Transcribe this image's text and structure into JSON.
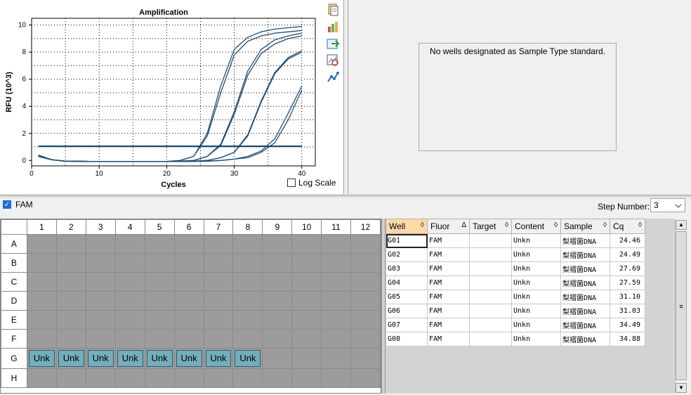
{
  "chart_data": {
    "type": "line",
    "title": "Amplification",
    "xlabel": "Cycles",
    "ylabel": "RFU (10^3)",
    "xlim": [
      0,
      42
    ],
    "ylim": [
      -0.4,
      10.5
    ],
    "xticks": [
      0,
      10,
      20,
      30,
      40
    ],
    "yticks": [
      0,
      2,
      4,
      6,
      8,
      10
    ],
    "grid": true,
    "threshold": 1.05,
    "series_color": "#1f4e79",
    "threshold_color": "#0b3d6e",
    "x": [
      1,
      3,
      5,
      10,
      15,
      20,
      22,
      24,
      26,
      28,
      30,
      32,
      34,
      36,
      38,
      40
    ],
    "series": [
      {
        "values": [
          0.35,
          0.05,
          -0.05,
          -0.08,
          -0.08,
          -0.07,
          0.0,
          0.3,
          2.0,
          5.5,
          8.2,
          9.1,
          9.5,
          9.7,
          9.8,
          9.9
        ]
      },
      {
        "values": [
          0.4,
          0.05,
          -0.05,
          -0.08,
          -0.08,
          -0.07,
          0.0,
          0.3,
          1.8,
          5.0,
          7.8,
          8.8,
          9.2,
          9.4,
          9.5,
          9.6
        ]
      },
      {
        "values": [
          0.3,
          0.05,
          -0.05,
          -0.08,
          -0.08,
          -0.08,
          -0.05,
          0.0,
          0.3,
          1.2,
          3.6,
          6.6,
          8.2,
          8.9,
          9.2,
          9.4
        ]
      },
      {
        "values": [
          0.3,
          0.05,
          -0.05,
          -0.08,
          -0.08,
          -0.08,
          -0.05,
          0.0,
          0.3,
          1.1,
          3.4,
          6.3,
          7.9,
          8.6,
          9.0,
          9.2
        ]
      },
      {
        "values": [
          0.35,
          0.05,
          -0.05,
          -0.08,
          -0.08,
          -0.08,
          -0.07,
          -0.05,
          0.0,
          0.2,
          0.6,
          1.8,
          4.3,
          6.4,
          7.5,
          8.0
        ]
      },
      {
        "values": [
          0.3,
          0.05,
          -0.05,
          -0.08,
          -0.08,
          -0.08,
          -0.07,
          -0.05,
          0.0,
          0.2,
          0.6,
          1.9,
          4.4,
          6.5,
          7.6,
          8.1
        ]
      },
      {
        "values": [
          0.3,
          0.05,
          -0.05,
          -0.08,
          -0.08,
          -0.08,
          -0.08,
          -0.07,
          -0.05,
          0.0,
          0.1,
          0.3,
          0.7,
          1.6,
          3.5,
          5.5
        ]
      },
      {
        "values": [
          0.3,
          0.05,
          -0.05,
          -0.08,
          -0.08,
          -0.08,
          -0.08,
          -0.07,
          -0.05,
          0.0,
          0.1,
          0.2,
          0.6,
          1.3,
          3.0,
          5.2
        ]
      }
    ]
  },
  "chart_pane": {
    "log_scale_label": "Log Scale",
    "toolbar_icons": [
      "copy-icon",
      "chart-settings-icon",
      "export-icon",
      "zoom-chart-icon",
      "plot-toggle-icon"
    ]
  },
  "standard_curve": {
    "message": "No wells designated as Sample Type standard."
  },
  "filters": {
    "fam_label": "FAM",
    "step_number_label": "Step Number:",
    "step_number_value": "3",
    "dropdown_icon": "chevron-down-icon"
  },
  "plate": {
    "columns": [
      "1",
      "2",
      "3",
      "4",
      "5",
      "6",
      "7",
      "8",
      "9",
      "10",
      "11",
      "12"
    ],
    "rows": [
      "A",
      "B",
      "C",
      "D",
      "E",
      "F",
      "G",
      "H"
    ],
    "filled_row": "G",
    "filled_cols": 8,
    "well_label": "Unk",
    "well_color": "#74aebd"
  },
  "well_table": {
    "columns": [
      "Well",
      "Fluor",
      "Target",
      "Content",
      "Sample",
      "Cq"
    ],
    "sort_glyphs": [
      "◊",
      "Δ",
      "◊",
      "◊",
      "◊",
      "◊"
    ],
    "rows": [
      [
        "G01",
        "FAM",
        "",
        "Unkn",
        "梨褶菌DNA",
        "24.46"
      ],
      [
        "G02",
        "FAM",
        "",
        "Unkn",
        "梨褶菌DNA",
        "24.49"
      ],
      [
        "G03",
        "FAM",
        "",
        "Unkn",
        "梨褶菌DNA",
        "27.69"
      ],
      [
        "G04",
        "FAM",
        "",
        "Unkn",
        "梨褶菌DNA",
        "27.59"
      ],
      [
        "G05",
        "FAM",
        "",
        "Unkn",
        "梨褶菌DNA",
        "31.10"
      ],
      [
        "G06",
        "FAM",
        "",
        "Unkn",
        "梨褶菌DNA",
        "31.03"
      ],
      [
        "G07",
        "FAM",
        "",
        "Unkn",
        "梨褶菌DNA",
        "34.49"
      ],
      [
        "G08",
        "FAM",
        "",
        "Unkn",
        "梨褶菌DNA",
        "34.88"
      ]
    ]
  }
}
